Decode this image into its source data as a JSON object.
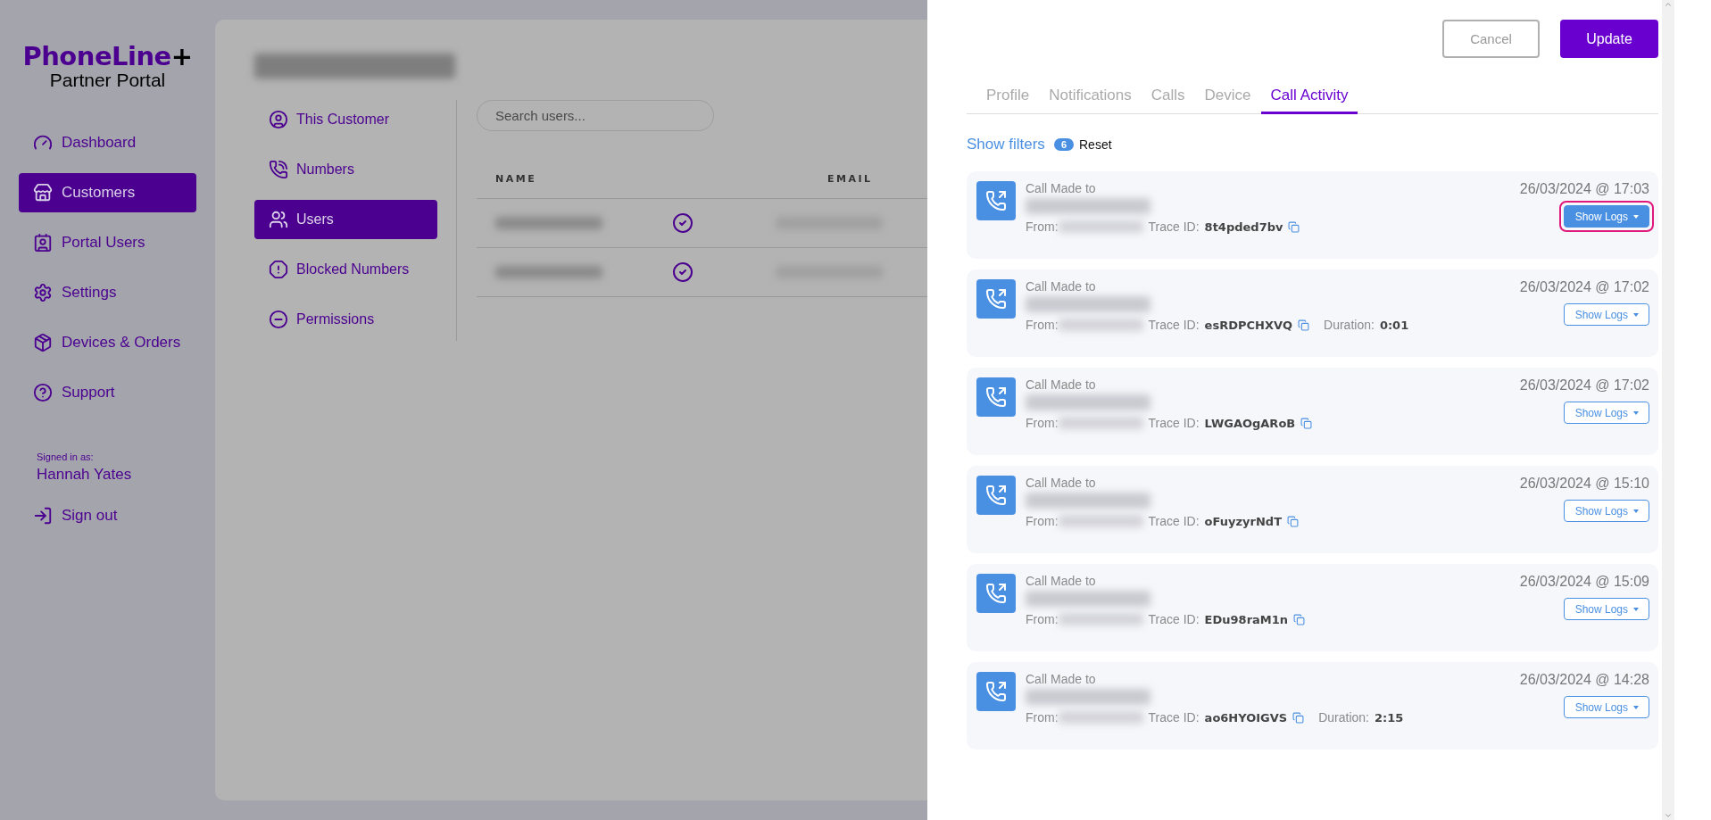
{
  "brand": {
    "name": "PhoneLine",
    "plus": "+",
    "subtitle": "Partner Portal"
  },
  "sidebar": {
    "items": [
      {
        "label": "Dashboard",
        "selected": false
      },
      {
        "label": "Customers",
        "selected": true
      },
      {
        "label": "Portal Users",
        "selected": false
      },
      {
        "label": "Settings",
        "selected": false
      },
      {
        "label": "Devices & Orders",
        "selected": false
      },
      {
        "label": "Support",
        "selected": false
      }
    ],
    "signed_in_label": "Signed in as:",
    "user": "Hannah Yates",
    "sign_out": "Sign out"
  },
  "customer": {
    "nav": [
      {
        "label": "This Customer",
        "selected": false
      },
      {
        "label": "Numbers",
        "selected": false
      },
      {
        "label": "Users",
        "selected": true
      },
      {
        "label": "Blocked Numbers",
        "selected": false
      },
      {
        "label": "Permissions",
        "selected": false
      }
    ],
    "search": {
      "placeholder": "Search users..."
    },
    "table": {
      "columns": [
        "NAME",
        "EMAIL"
      ],
      "rows": [
        {
          "verified": true
        },
        {
          "verified": true
        }
      ]
    }
  },
  "drawer": {
    "cancel": "Cancel",
    "update": "Update",
    "tabs": [
      {
        "label": "Profile",
        "selected": false
      },
      {
        "label": "Notifications",
        "selected": false
      },
      {
        "label": "Calls",
        "selected": false
      },
      {
        "label": "Device",
        "selected": false
      },
      {
        "label": "Call Activity",
        "selected": true
      }
    ],
    "filters": {
      "label": "Show filters",
      "count": "6",
      "reset": "Reset"
    },
    "calls": [
      {
        "title": "Call Made to",
        "time": "26/03/2024 @ 17:03",
        "from_label": "From:",
        "trace_label": "Trace ID:",
        "trace_id": "8t4pded7bv",
        "logs_button": "Show Logs",
        "selected": true
      },
      {
        "title": "Call Made to",
        "time": "26/03/2024 @ 17:02",
        "from_label": "From:",
        "trace_label": "Trace ID:",
        "trace_id": "esRDPCHXVQ",
        "duration_label": "Duration:",
        "duration": "0:01",
        "logs_button": "Show Logs",
        "selected": false
      },
      {
        "title": "Call Made to",
        "time": "26/03/2024 @ 17:02",
        "from_label": "From:",
        "trace_label": "Trace ID:",
        "trace_id": "LWGAOgARoB",
        "logs_button": "Show Logs",
        "selected": false
      },
      {
        "title": "Call Made to",
        "time": "26/03/2024 @ 15:10",
        "from_label": "From:",
        "trace_label": "Trace ID:",
        "trace_id": "oFuyzyrNdT",
        "logs_button": "Show Logs",
        "selected": false
      },
      {
        "title": "Call Made to",
        "time": "26/03/2024 @ 15:09",
        "from_label": "From:",
        "trace_label": "Trace ID:",
        "trace_id": "EDu98raM1n",
        "logs_button": "Show Logs",
        "selected": false
      },
      {
        "title": "Call Made to",
        "time": "26/03/2024 @ 14:28",
        "from_label": "From:",
        "trace_label": "Trace ID:",
        "trace_id": "ao6HYOIGVS",
        "duration_label": "Duration:",
        "duration": "2:15",
        "logs_button": "Show Logs",
        "selected": false
      }
    ]
  }
}
